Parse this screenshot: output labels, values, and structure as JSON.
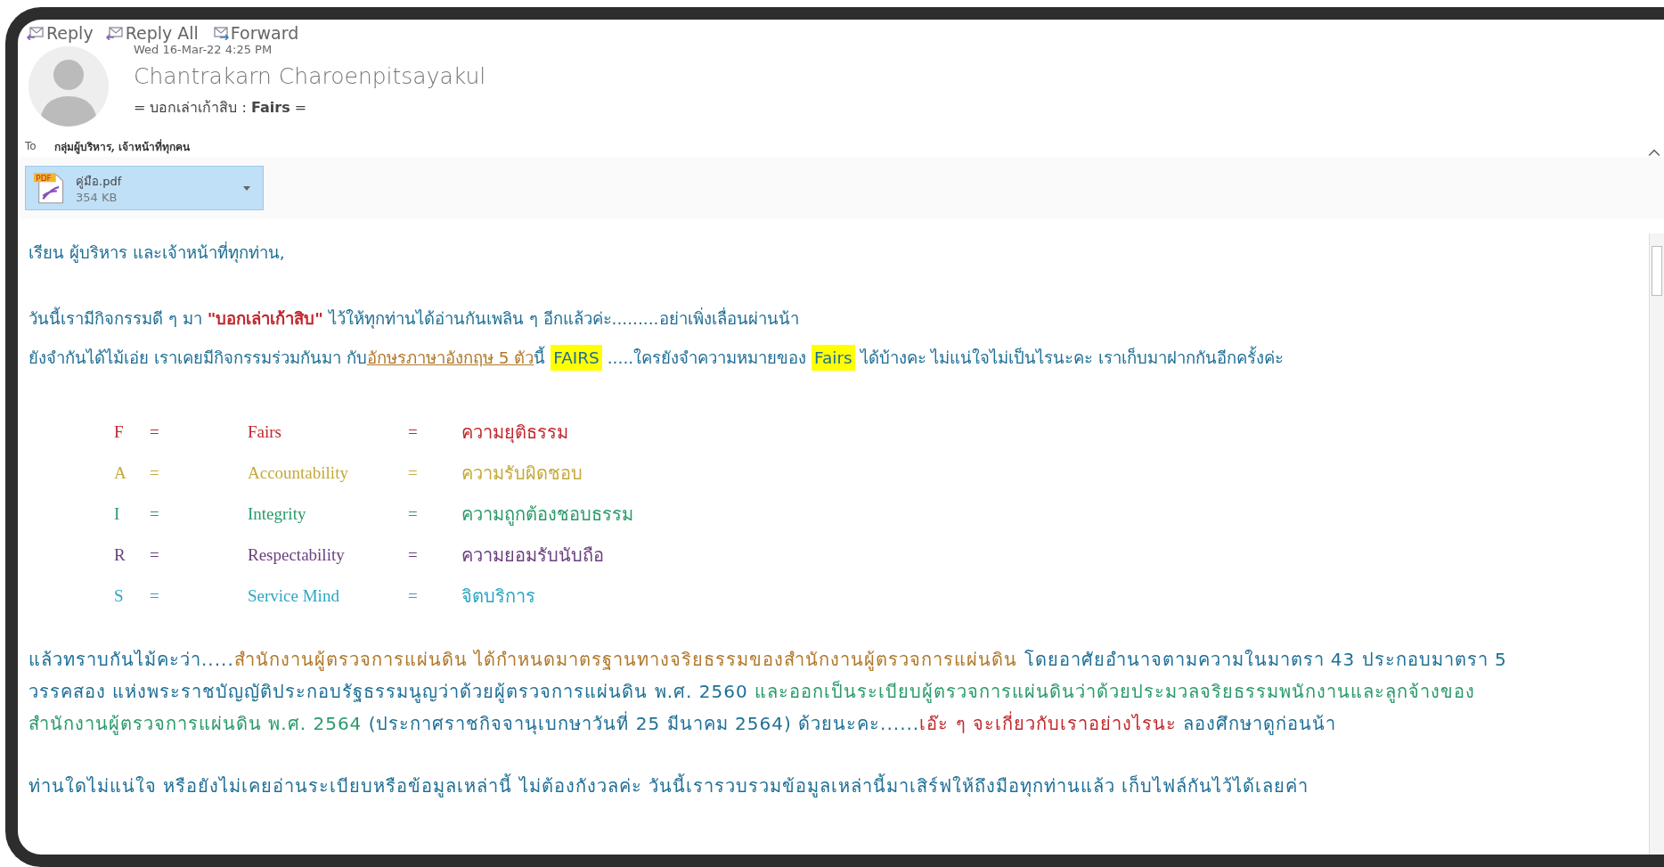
{
  "toolbar": [
    {
      "label": "Reply",
      "kind": "reply"
    },
    {
      "label": "Reply All",
      "kind": "replyall"
    },
    {
      "label": "Forward",
      "kind": "forward"
    }
  ],
  "message": {
    "date": "Wed 16-Mar-22 4:25 PM",
    "sender": "Chantrakarn Charoenpitsayakul",
    "subject": "= บอกเล่าเก้าสิบ : **Fairs** =",
    "to_label": "To",
    "to": "กลุ่มผู้บริหาร, เจ้าหน้าที่ทุกคน"
  },
  "attachment": {
    "name": "คู่มือ.pdf",
    "size": "354 KB",
    "type": "PDF"
  },
  "body": [
    {
      "segments": [
        {
          "text": "เรียน ผู้บริหาร และเจ้าหน้าที่ทุกท่าน,",
          "color": "#1f6f96",
          "kind": "plain"
        }
      ]
    },
    {
      "segments": [
        {
          "text": "วันนี้เรามีกิจกรรมดี ๆ มา ",
          "color": "#1f6f96",
          "kind": "plain"
        },
        {
          "text": "\"บอกเล่าเก้าสิบ\"",
          "color": "#c0282d",
          "kind": "bold"
        },
        {
          "text": " ไว้ให้ทุกท่านได้อ่านกันเพลิน ๆ อีกแล้วค่ะ.........อย่าเพิ่งเลื่อนผ่านน้า",
          "color": "#1f6f96",
          "kind": "plain"
        }
      ]
    },
    {
      "segments": [
        {
          "text": "ยังจำกันได้ไม้เอ่ย เราเคยมีกิจกรรมร่วมกันมา กับ",
          "color": "#1f6f96",
          "kind": "plain"
        },
        {
          "text": "อักษรภาษาอังกฤษ 5 ตัว",
          "color": "#b0782a",
          "kind": "link"
        },
        {
          "text": "นี้ ",
          "color": "#1f6f96",
          "kind": "plain"
        },
        {
          "text": "FAIRS",
          "color": "#1f6f96",
          "kind": "highlight"
        },
        {
          "text": " .....ใครยังจำความหมายของ ",
          "color": "#1f6f96",
          "kind": "plain"
        },
        {
          "text": "Fairs",
          "color": "#1f6f96",
          "kind": "highlight"
        },
        {
          "text": " ได้บ้างคะ ไม่แน่ใจไม่เป็นไรนะคะ เราเก็บมาฝากกันอีกครั้งค่ะ",
          "color": "#1f6f96",
          "kind": "plain"
        }
      ]
    }
  ],
  "fairs": [
    {
      "letter": "F",
      "eq1": "=",
      "word": "Fairs",
      "eq2": "=",
      "meaning": "ความยุติธรรม",
      "color": "#c0282d"
    },
    {
      "letter": "A",
      "eq1": "=",
      "word": "Accountability",
      "eq2": "=",
      "meaning": "ความรับผิดชอบ",
      "color": "#c4a93a"
    },
    {
      "letter": "I",
      "eq1": "=",
      "word": "Integrity",
      "eq2": "=",
      "meaning": "ความถูกต้องชอบธรรม",
      "color": "#2a9a6a"
    },
    {
      "letter": "R",
      "eq1": "=",
      "word": "Respectability",
      "eq2": "=",
      "meaning": "ความยอมรับนับถือ",
      "color": "#6a3f7e"
    },
    {
      "letter": "S",
      "eq1": "=",
      "word": "Service Mind",
      "eq2": "=",
      "meaning": "จิตบริการ",
      "color": "#2ba6c4"
    }
  ],
  "closing": [
    {
      "lines": [
        {
          "segments": [
            {
              "text": "แล้วทราบกันไม้คะว่า.....",
              "color": "#1f6f96",
              "kind": "plain"
            },
            {
              "text": "สำนักงานผู้ตรวจการแผ่นดิน ได้กำหนดมาตรฐานทางจริยธรรมของสำนักงานผู้ตรวจการแผ่นดิน",
              "color": "#b0782a",
              "kind": "plain"
            },
            {
              "text": " โดยอาศัยอำนาจตามความในมาตรา 43 ประกอบมาตรา 5",
              "color": "#1f6f96",
              "kind": "plain"
            }
          ]
        },
        {
          "segments": [
            {
              "text": "วรรคสอง แห่งพระราชบัญญัติประกอบรัฐธรรมนูญว่าด้วยผู้ตรวจการแผ่นดิน พ.ศ. 2560",
              "color": "#1f6f96",
              "kind": "plain"
            },
            {
              "text": " และออกเป็นระเบียบผู้ตรวจการแผ่นดินว่าด้วยประมวลจริยธรรมพนักงานและลูกจ้างของ",
              "color": "#2a9a6a",
              "kind": "plain"
            }
          ]
        },
        {
          "segments": [
            {
              "text": "สำนักงานผู้ตรวจการแผ่นดิน พ.ศ. 2564",
              "color": "#2a9a6a",
              "kind": "plain"
            },
            {
              "text": " (ประกาศราชกิจจานุเบกษาวันที่ 25 มีนาคม 2564) ด้วยนะคะ......",
              "color": "#1f6f96",
              "kind": "plain"
            },
            {
              "text": "เอ๊ะ ๆ จะเกี่ยวกับเราอย่างไรนะ",
              "color": "#c0282d",
              "kind": "plain"
            },
            {
              "text": " ลองศึกษาดูก่อนน้า",
              "color": "#1f6f96",
              "kind": "plain"
            }
          ]
        }
      ]
    },
    {
      "lines": [
        {
          "segments": [
            {
              "text": "ท่านใดไม่แน่ใจ หรือยังไม่เคยอ่านระเบียบหรือข้อมูลเหล่านี้ ไม่ต้องกังวลค่ะ วันนี้เรารวบรวมข้อมูลเหล่านี้มาเสิร์ฟให้ถึงมือทุกท่านแล้ว เก็บไฟล์กันไว้ได้เลยค่า",
              "color": "#1f6f96",
              "kind": "plain"
            }
          ]
        }
      ]
    }
  ]
}
